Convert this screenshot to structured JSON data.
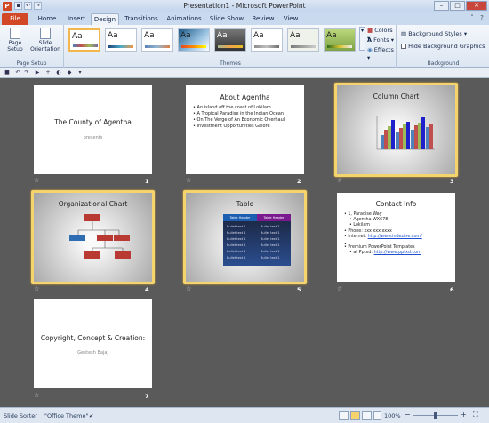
{
  "window": {
    "title": "Presentation1 - Microsoft PowerPoint",
    "app_icon": "P"
  },
  "tabs": [
    "File",
    "Home",
    "Insert",
    "Design",
    "Transitions",
    "Animations",
    "Slide Show",
    "Review",
    "View"
  ],
  "ribbon": {
    "page_setup": {
      "btn1": "Page Setup",
      "btn2": "Slide Orientation",
      "group_label": "Page Setup"
    },
    "themes": {
      "sample": "Aa",
      "group_label": "Themes"
    },
    "theme_opts": {
      "colors": "Colors",
      "fonts": "Fonts",
      "effects": "Effects"
    },
    "background": {
      "styles": "Background Styles",
      "hide": "Hide Background Graphics",
      "group_label": "Background"
    }
  },
  "slides": [
    {
      "num": "1",
      "title": "The County of Agentha",
      "subtitle": "presents"
    },
    {
      "num": "2",
      "title": "About Agentha",
      "bullets": [
        "An island off the coast of Lokilam",
        "A Tropical Paradise in the Indian Ocean",
        "On The Verge of An Economic Overhaul",
        "Investment Opportunities Galore"
      ]
    },
    {
      "num": "3",
      "title": "Column Chart"
    },
    {
      "num": "4",
      "title": "Organizational Chart"
    },
    {
      "num": "5",
      "title": "Table",
      "th1": "Table Header",
      "th2": "Table Header",
      "row_text": "Bullet text 1"
    },
    {
      "num": "6",
      "title": "Contact Info",
      "addr": "1, Paradise Way",
      "addr2": "Agentha WX678",
      "addr3": "Lokilam",
      "phone": "Phone: xxx xxx xxxx",
      "internet": "Internet: ",
      "link1": "http://www.indezine.com/",
      "premium": "Premium PowerPoint Templates",
      "at": "at Pptxd: ",
      "link2": "http://www.pptxd.com"
    },
    {
      "num": "7",
      "title": "Copyright, Concept & Creation:",
      "subtitle": "Geetesh Bajaj"
    }
  ],
  "status": {
    "view": "Slide Sorter",
    "theme": "\"Office Theme\"",
    "zoom": "100%"
  },
  "colors": {
    "file_tab": "#d24726",
    "selection": "#f5d46d"
  }
}
